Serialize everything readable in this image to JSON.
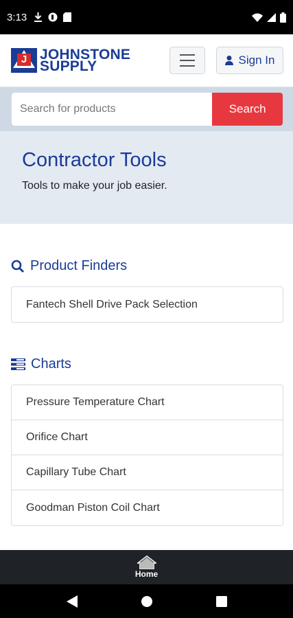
{
  "status_bar": {
    "time": "3:13"
  },
  "header": {
    "logo_line1": "JOHNSTONE",
    "logo_line2": "SUPPLY",
    "logo_mark_letter": "J",
    "signin_label": "Sign In"
  },
  "search": {
    "placeholder": "Search for products",
    "button_label": "Search"
  },
  "hero": {
    "title": "Contractor Tools",
    "subtitle": "Tools to make your job easier."
  },
  "product_finders": {
    "title": "Product Finders",
    "items": [
      {
        "label": "Fantech Shell Drive Pack Selection"
      }
    ]
  },
  "charts": {
    "title": "Charts",
    "items": [
      {
        "label": "Pressure Temperature Chart"
      },
      {
        "label": "Orifice Chart"
      },
      {
        "label": "Capillary Tube Chart"
      },
      {
        "label": "Goodman Piston Coil Chart"
      }
    ]
  },
  "bottom_nav": {
    "home_label": "Home"
  },
  "colors": {
    "brand_blue": "#1a3c96",
    "search_red": "#e8383f",
    "hero_bg": "#e4eaf2",
    "search_band_bg": "#cfd9e6"
  }
}
